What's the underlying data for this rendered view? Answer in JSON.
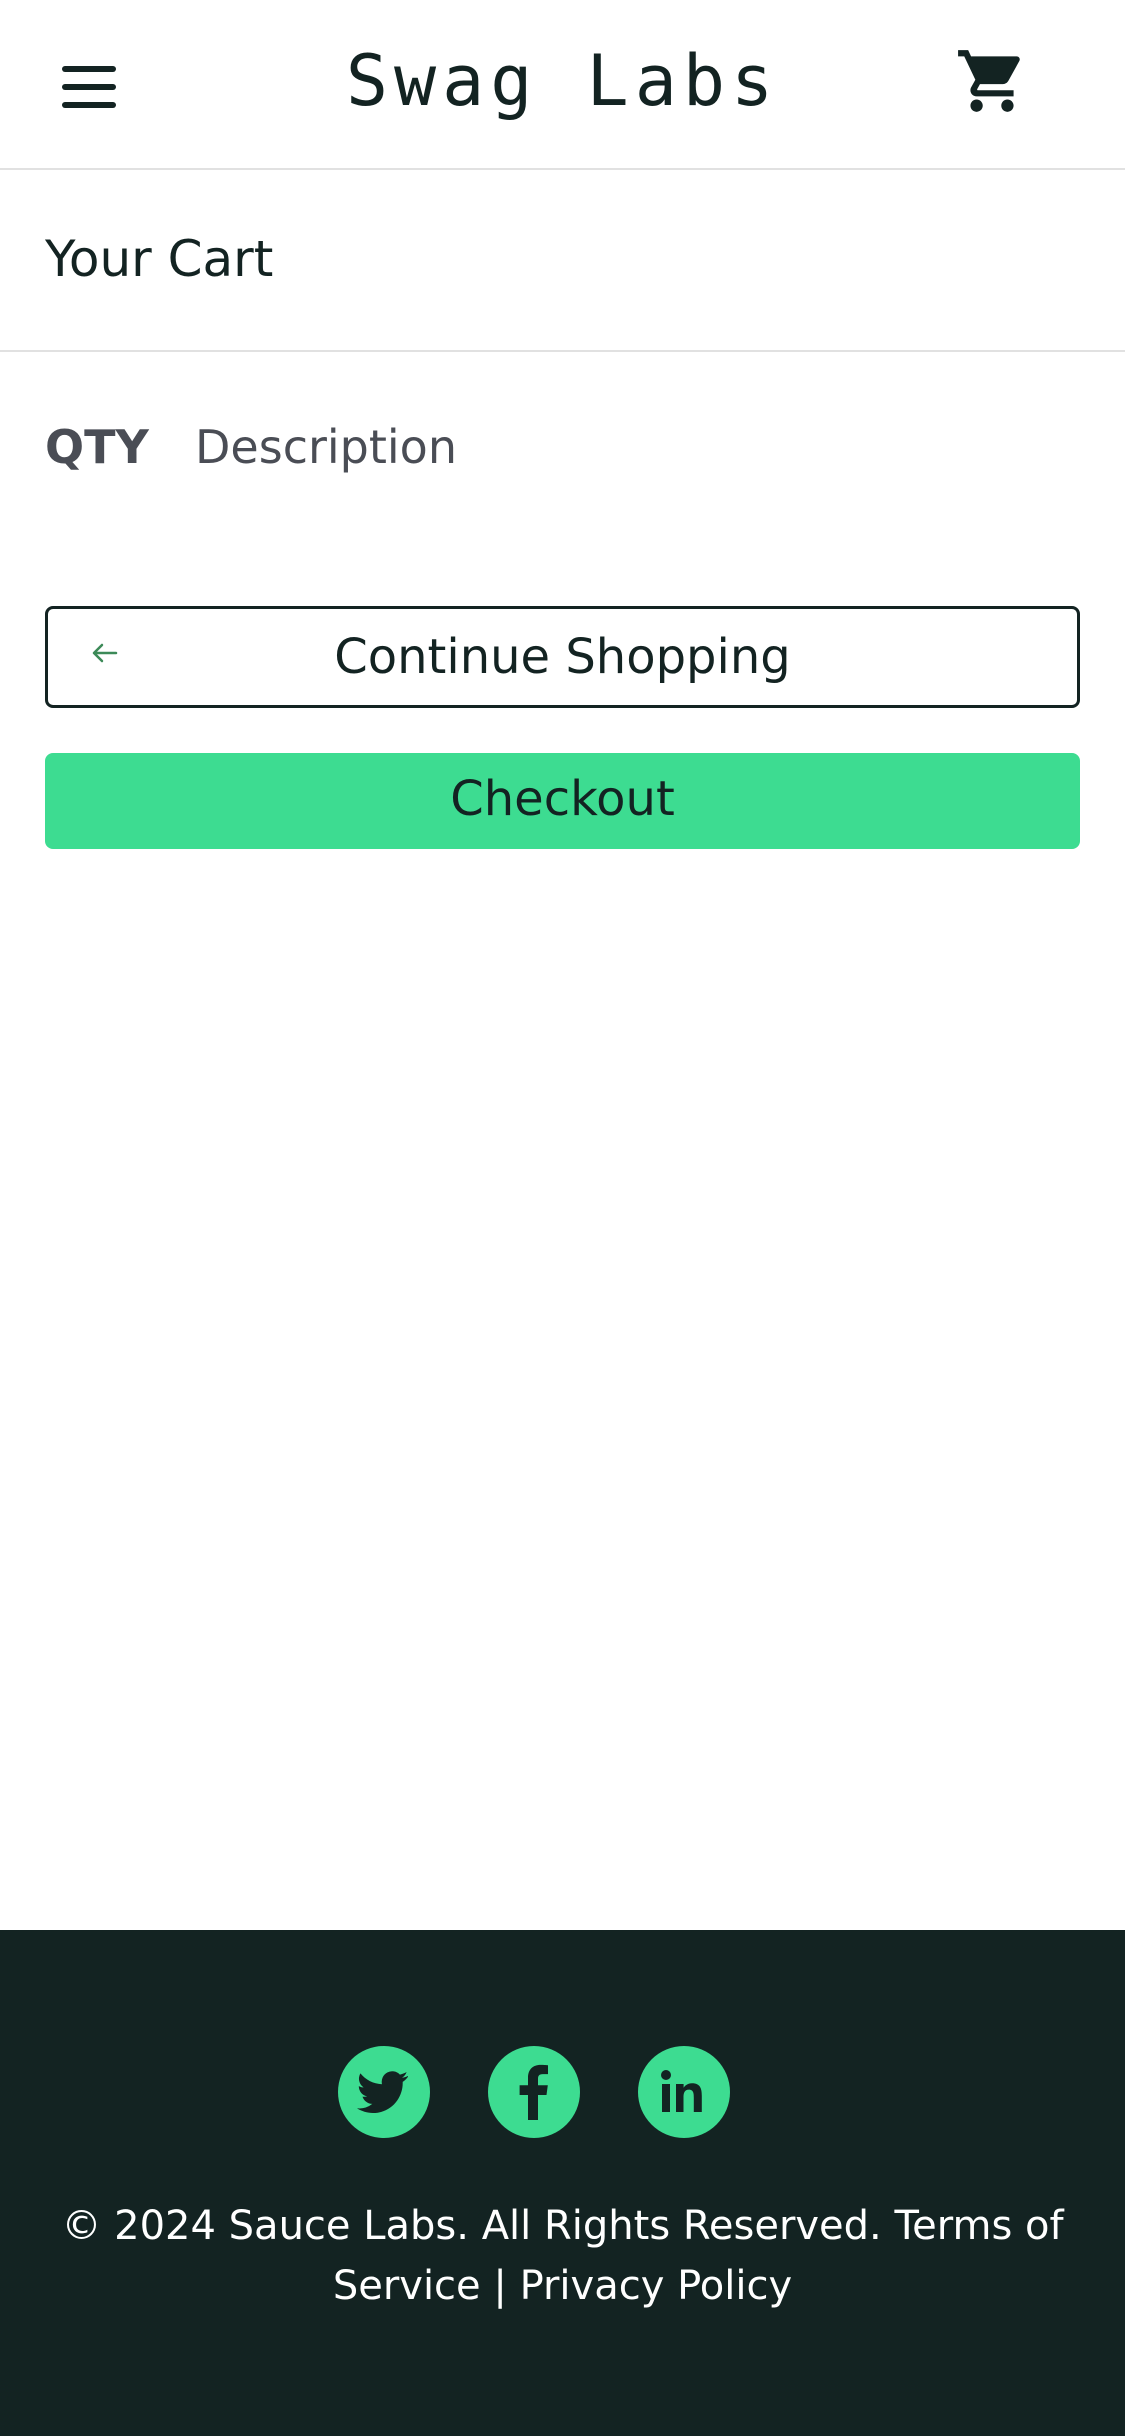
{
  "header": {
    "app_logo": "Swag  Labs",
    "menu_icon": "hamburger-menu-icon",
    "cart_icon": "shopping-cart-icon"
  },
  "page": {
    "title": "Your Cart"
  },
  "cart_list": {
    "qty_label": "QTY",
    "description_label": "Description",
    "items": []
  },
  "actions": {
    "continue_shopping_label": "Continue Shopping",
    "continue_icon": "arrow-left-icon",
    "checkout_label": "Checkout"
  },
  "footer": {
    "social_icons": [
      "twitter-icon",
      "facebook-icon",
      "linkedin-icon"
    ],
    "copy_text": "© 2024 Sauce Labs. All Rights Reserved. Terms of Service | Privacy Policy"
  },
  "colors": {
    "accent": "#3ddc91",
    "dark": "#132322",
    "divider": "#e1e1e1",
    "muted_text": "#4a4d55"
  }
}
